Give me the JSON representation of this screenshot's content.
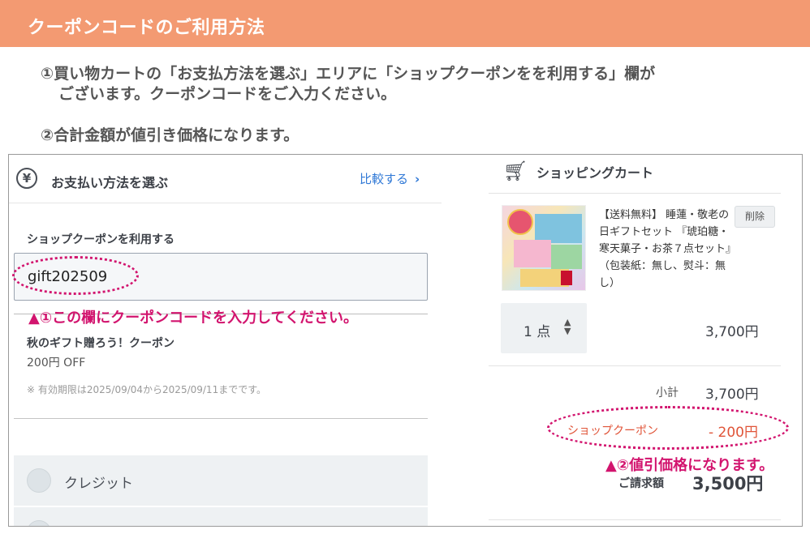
{
  "header": {
    "title": "クーポンコードのご利用方法"
  },
  "steps": {
    "step1_line1": "①買い物カートの「お支払方法を選ぶ」エリアに「ショップクーポンをを利用する」欄が",
    "step1_line2": "ございます。クーポンコードをご入力ください。",
    "step2": "②合計金額が値引き価格になります。"
  },
  "payment": {
    "icon": "yen-icon",
    "title": "お支払い方法を選ぶ",
    "compare_label": "比較する",
    "compare_chevron": "›",
    "coupon_label": "ショップクーポンを利用する",
    "coupon_value": "gift202509",
    "coupon_name": "秋のギフト贈ろう！クーポン",
    "coupon_off": "200円 OFF",
    "coupon_validity": "※ 有効期限は2025/09/04から2025/09/11までです。",
    "options": [
      {
        "label": "クレジット"
      },
      {
        "label": ""
      }
    ]
  },
  "annotations": {
    "note1": "▲①この欄にクーポンコードを入力してください。",
    "note2": "▲②値引価格になります。",
    "color": "#d2146e"
  },
  "cart": {
    "icon": "cart-icon",
    "title": "ショッピングカート",
    "product_name": "【送料無料】 睡蓮・敬老の日ギフトセット 『琥珀糖・寒天菓子・お茶７点セット』（包装紙：無し、熨斗：無し）",
    "delete_label": "削除",
    "quantity": "1 点",
    "price": "3,700円",
    "subtotal_label": "小計",
    "subtotal_value": "3,700円",
    "coupon_label": "ショップクーポン",
    "coupon_value": "- 200円",
    "total_label": "ご請求額",
    "total_value": "3,500円"
  },
  "colors": {
    "header_bg": "#f39a72",
    "link": "#2f78d6",
    "discount": "#e05438"
  }
}
